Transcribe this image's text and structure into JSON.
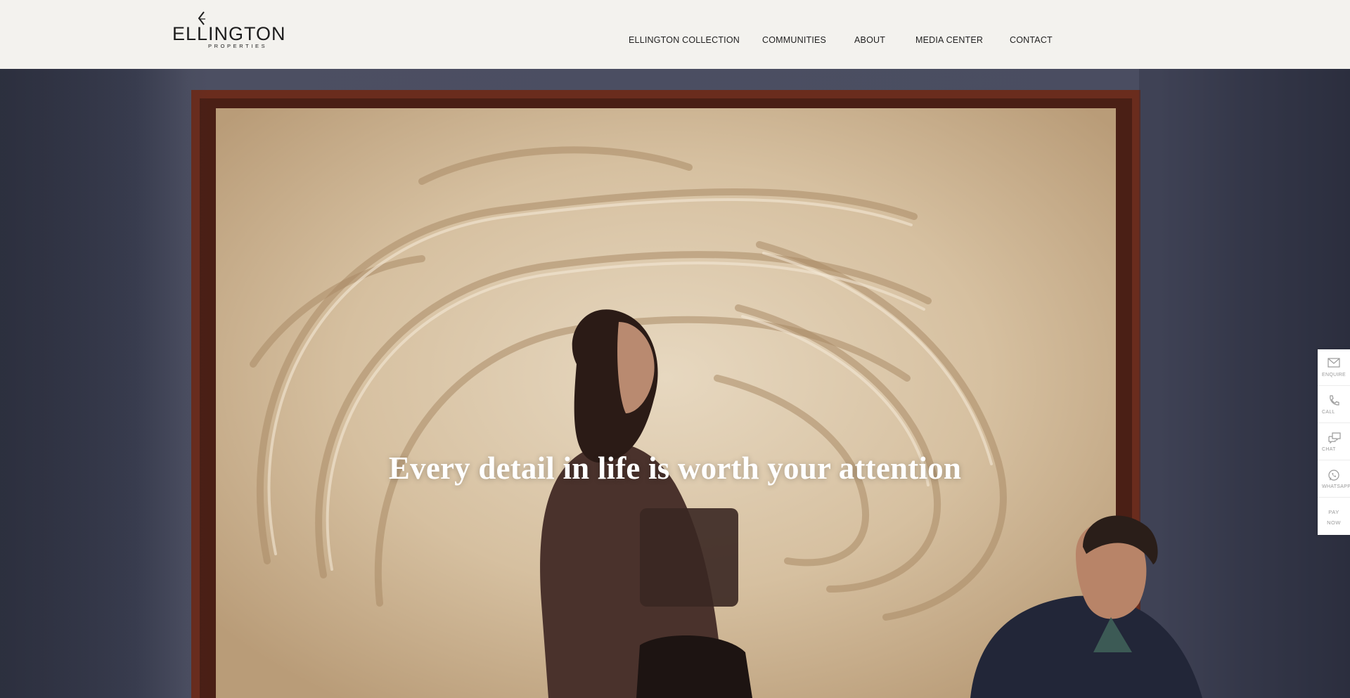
{
  "brand": {
    "name": "ELLINGTON",
    "subtitle": "PROPERTIES"
  },
  "nav": {
    "items": [
      {
        "label": "ELLINGTON COLLECTION"
      },
      {
        "label": "COMMUNITIES"
      },
      {
        "label": "ABOUT"
      },
      {
        "label": "MEDIA CENTER"
      },
      {
        "label": "CONTACT"
      }
    ]
  },
  "hero": {
    "headline": "Every detail in life is worth your attention"
  },
  "side_actions": {
    "items": [
      {
        "label": "ENQUIRE",
        "icon": "mail-icon"
      },
      {
        "label": "CALL",
        "icon": "phone-icon"
      },
      {
        "label": "CHAT",
        "icon": "chat-icon"
      },
      {
        "label": "WHATSAPP",
        "icon": "whatsapp-icon"
      }
    ],
    "pay": {
      "line1": "PAY",
      "line2": "NOW"
    }
  },
  "colors": {
    "header_bg": "#f3f2ee",
    "text_dark": "#1f1f1f",
    "side_label": "#9a9a9a"
  }
}
